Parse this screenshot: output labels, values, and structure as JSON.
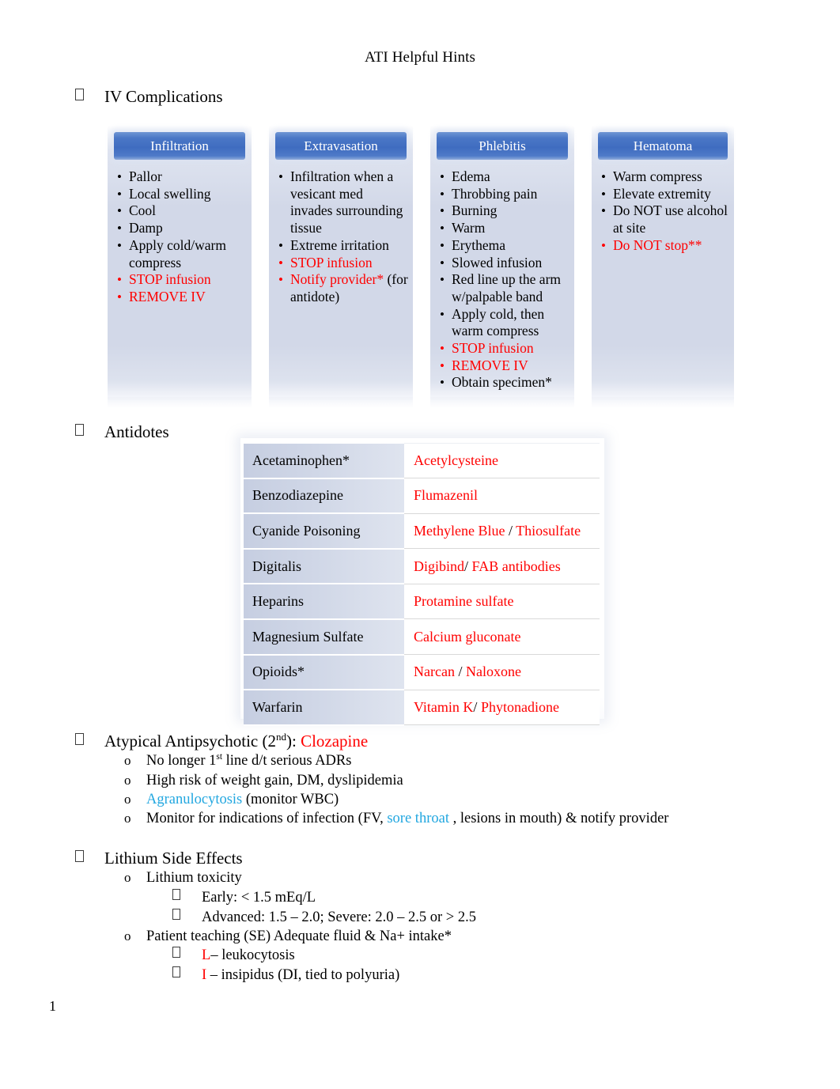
{
  "document": {
    "title": "ATI Helpful Hints",
    "page_number": "1"
  },
  "colors": {
    "red": "#FF0000",
    "cyan": "#22A7E0",
    "header_blue": "#3F6CC0",
    "box_fill": "#D2D8E8",
    "table_left_fill": "#D0D7E7"
  },
  "sections": {
    "iv_complications": {
      "heading": "IV Complications",
      "boxes": [
        {
          "title": "Infiltration",
          "items": [
            {
              "text": "Pallor",
              "color": "black"
            },
            {
              "text": "Local swelling",
              "color": "black"
            },
            {
              "text": "Cool",
              "color": "black"
            },
            {
              "text": "Damp",
              "color": "black"
            },
            {
              "text": "Apply cold/warm compress",
              "color": "black"
            },
            {
              "text": "STOP infusion",
              "color": "red"
            },
            {
              "text": "REMOVE IV",
              "color": "red"
            }
          ]
        },
        {
          "title": "Extravasation",
          "items": [
            {
              "text": "Infiltration when a vesicant med invades surrounding tissue",
              "color": "black"
            },
            {
              "text": "Extreme irritation",
              "color": "black"
            },
            {
              "text": "STOP infusion",
              "color": "red"
            },
            {
              "text": "Notify provider*",
              "color": "red",
              "suffix": " (for antidote)",
              "suffix_color": "black"
            }
          ]
        },
        {
          "title": "Phlebitis",
          "items": [
            {
              "text": "Edema",
              "color": "black"
            },
            {
              "text": "Throbbing pain",
              "color": "black"
            },
            {
              "text": "Burning",
              "color": "black"
            },
            {
              "text": "Warm",
              "color": "black"
            },
            {
              "text": "Erythema",
              "color": "black"
            },
            {
              "text": "Slowed infusion",
              "color": "black"
            },
            {
              "text": "Red line up the arm w/palpable band",
              "color": "black"
            },
            {
              "text": "Apply cold, then warm compress",
              "color": "black"
            },
            {
              "text": "STOP infusion",
              "color": "red"
            },
            {
              "text": "REMOVE IV",
              "color": "red"
            },
            {
              "text": "Obtain specimen*",
              "color": "black"
            }
          ]
        },
        {
          "title": "Hematoma",
          "items": [
            {
              "text": "Warm  compress",
              "color": "black"
            },
            {
              "text": "Elevate extremity",
              "color": "black"
            },
            {
              "text": "Do NOT use alcohol at site",
              "color": "black"
            },
            {
              "text": "Do NOT stop**",
              "color": "red"
            }
          ]
        }
      ]
    },
    "antidotes": {
      "heading": "Antidotes",
      "rows": [
        {
          "drug": "Acetaminophen*",
          "antidote_parts": [
            {
              "text": "Acetylcysteine",
              "color": "red"
            }
          ]
        },
        {
          "drug": "Benzodiazepine",
          "antidote_parts": [
            {
              "text": "Flumazenil",
              "color": "red"
            }
          ]
        },
        {
          "drug": "Cyanide Poisoning",
          "antidote_parts": [
            {
              "text": "Methylene Blue ",
              "color": "red"
            },
            {
              "text": "/",
              "color": "black"
            },
            {
              "text": " Thiosulfate",
              "color": "red"
            }
          ]
        },
        {
          "drug": "Digitalis",
          "antidote_parts": [
            {
              "text": "Digibind",
              "color": "red"
            },
            {
              "text": "/",
              "color": "black"
            },
            {
              "text": " FAB antibodies",
              "color": "red"
            }
          ]
        },
        {
          "drug": "Heparins",
          "antidote_parts": [
            {
              "text": "Protamine sulfate",
              "color": "red"
            }
          ]
        },
        {
          "drug": "Magnesium Sulfate",
          "antidote_parts": [
            {
              "text": "Calcium gluconate",
              "color": "red"
            }
          ]
        },
        {
          "drug": "Opioids*",
          "antidote_parts": [
            {
              "text": "Narcan ",
              "color": "red"
            },
            {
              "text": "/",
              "color": "black"
            },
            {
              "text": " Naloxone",
              "color": "red"
            }
          ]
        },
        {
          "drug": "Warfarin",
          "antidote_parts": [
            {
              "text": "Vitamin K",
              "color": "red"
            },
            {
              "text": "/",
              "color": "black"
            },
            {
              "text": " Phytonadione",
              "color": "red"
            }
          ]
        }
      ]
    },
    "atypical_antipsychotic": {
      "heading_prefix": "Atypical Antipsychotic (2",
      "heading_sup": "nd",
      "heading_mid": "): ",
      "heading_drug": "Clozapine",
      "bullets": [
        {
          "pre": "No longer 1",
          "sup": "st",
          "post": " line d/t serious ADRs"
        },
        {
          "pre": "High risk of weight gain, DM, dyslipidemia"
        },
        {
          "cyan": "Agranulocytosis",
          "post": " (monitor WBC)"
        },
        {
          "pre": "Monitor for indications of infection (FV,",
          "cyan": " sore throat ",
          "post": ", lesions in mouth) & notify provider"
        }
      ]
    },
    "lithium": {
      "heading_a": "Lithium",
      "heading_b": " Side Effects",
      "sub1": "Lithium toxicity",
      "sub1_items": [
        "Early: < 1.5 mEq/L",
        "Advanced: 1.5 – 2.0; Severe: 2.0 – 2.5 or > 2.5"
      ],
      "sub2": "Patient teaching (SE) Adequate fluid & Na+ intake*",
      "sub2_items": [
        {
          "letter": "L",
          "rest": "– leukocytosis"
        },
        {
          "letter": "I",
          "rest": " – insipidus (DI, tied to polyuria)"
        }
      ]
    }
  }
}
